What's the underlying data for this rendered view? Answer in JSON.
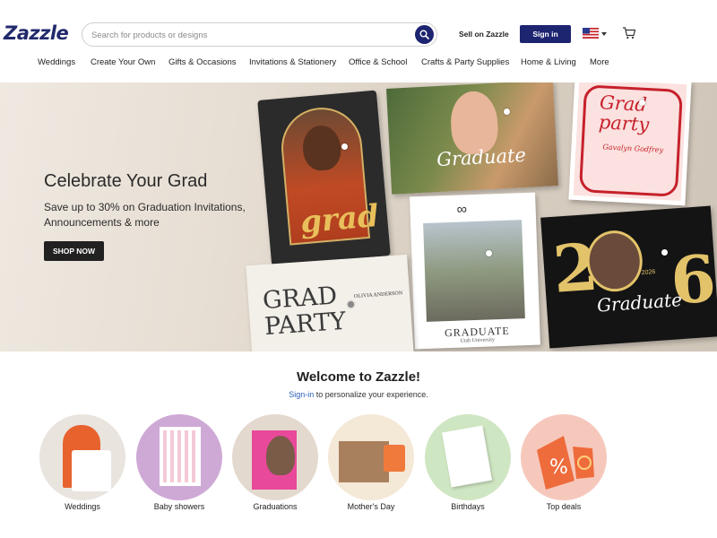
{
  "header": {
    "logo": "Zazzle",
    "search_placeholder": "Search for products or designs",
    "sell_label": "Sell on Zazzle",
    "signin_label": "Sign in",
    "icons": {
      "search": "search-icon",
      "flag": "us-flag-icon",
      "cart": "cart-icon"
    }
  },
  "nav": {
    "items": [
      {
        "label": "Weddings"
      },
      {
        "label": "Create Your Own"
      },
      {
        "label": "Gifts & Occasions"
      },
      {
        "label": "Invitations & Stationery"
      },
      {
        "label": "Office & School"
      },
      {
        "label": "Crafts & Party Supplies"
      },
      {
        "label": "Home & Living"
      },
      {
        "label": "More"
      }
    ]
  },
  "hero": {
    "title": "Celebrate Your Grad",
    "subtitle": "Save up to 30% on Graduation Invitations, Announcements & more",
    "cta": "SHOP NOW",
    "cards": {
      "grad_script": "grad",
      "graduate_script": "Graduate",
      "grad_party": "Grad party",
      "grad_party_name": "Gavalyn Godfrey",
      "graduate_serif": "GRADUATE",
      "graduate_serif_sub": "Utah University",
      "grad_party_big": "GRAD PARTY",
      "olivia": "OLIVIA ANDERSON",
      "year_left": "2",
      "year_right": "6",
      "graduate_2026": "Graduate",
      "year_small": "2026"
    }
  },
  "welcome": {
    "title": "Welcome to Zazzle!",
    "signin_link": "Sign-in",
    "subtitle_rest": " to personalize your experience."
  },
  "categories": [
    {
      "label": "Weddings",
      "bg": "#e9e4de"
    },
    {
      "label": "Baby showers",
      "bg": "#cfa9d6"
    },
    {
      "label": "Graduations",
      "bg": "#e4d9ce"
    },
    {
      "label": "Mother's Day",
      "bg": "#f4e8d7"
    },
    {
      "label": "Birthdays",
      "bg": "#cfe6c2"
    },
    {
      "label": "Top deals",
      "bg": "#f6c8bc"
    }
  ],
  "colors": {
    "brand_navy": "#1d2470",
    "link": "#2b5fb7",
    "cta_dark": "#212121"
  }
}
